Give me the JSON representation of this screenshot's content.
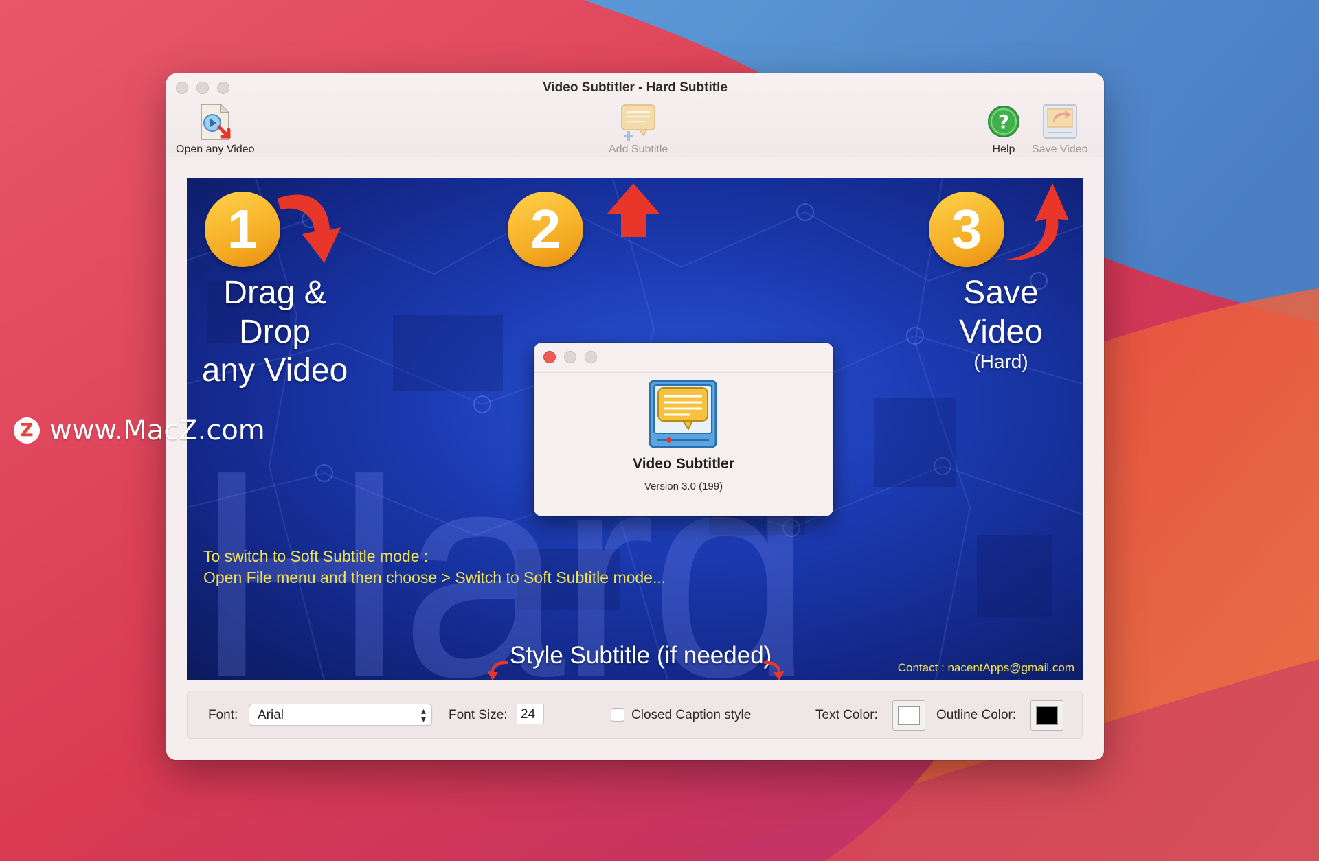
{
  "window": {
    "title": "Video Subtitler - Hard Subtitle"
  },
  "toolbar": {
    "open_label": "Open any Video",
    "add_label": "Add Subtitle",
    "help_label": "Help",
    "save_label": "Save Video"
  },
  "video": {
    "step1_number": "1",
    "step1_line1": "Drag & Drop",
    "step1_line2": "any Video",
    "step2_number": "2",
    "step3_number": "3",
    "step3_line1": "Save",
    "step3_line2": "Video",
    "step3_line3": "(Hard)",
    "background_word": "Hard",
    "note_line1": "To switch to Soft Subtitle mode :",
    "note_line2": "Open File menu and then choose > Switch to Soft Subtitle mode...",
    "style_subtitle": "Style Subtitle (if needed)",
    "contact": "Contact : nacentApps@gmail.com"
  },
  "about": {
    "app_name": "Video Subtitler",
    "version": "Version 3.0 (199)"
  },
  "controls": {
    "font_label": "Font:",
    "font_value": "Arial",
    "font_size_label": "Font Size:",
    "font_size_value": "24",
    "closed_caption_label": "Closed Caption style",
    "closed_caption_checked": false,
    "text_color_label": "Text Color:",
    "text_color": "#ffffff",
    "outline_color_label": "Outline Color:",
    "outline_color": "#000000"
  },
  "watermark": {
    "badge": "Z",
    "text": "www.MacZ.com"
  },
  "colors": {
    "accent_yellow": "#f1e34a",
    "badge_orange": "#f4a821",
    "arrow_red": "#e8362a"
  }
}
